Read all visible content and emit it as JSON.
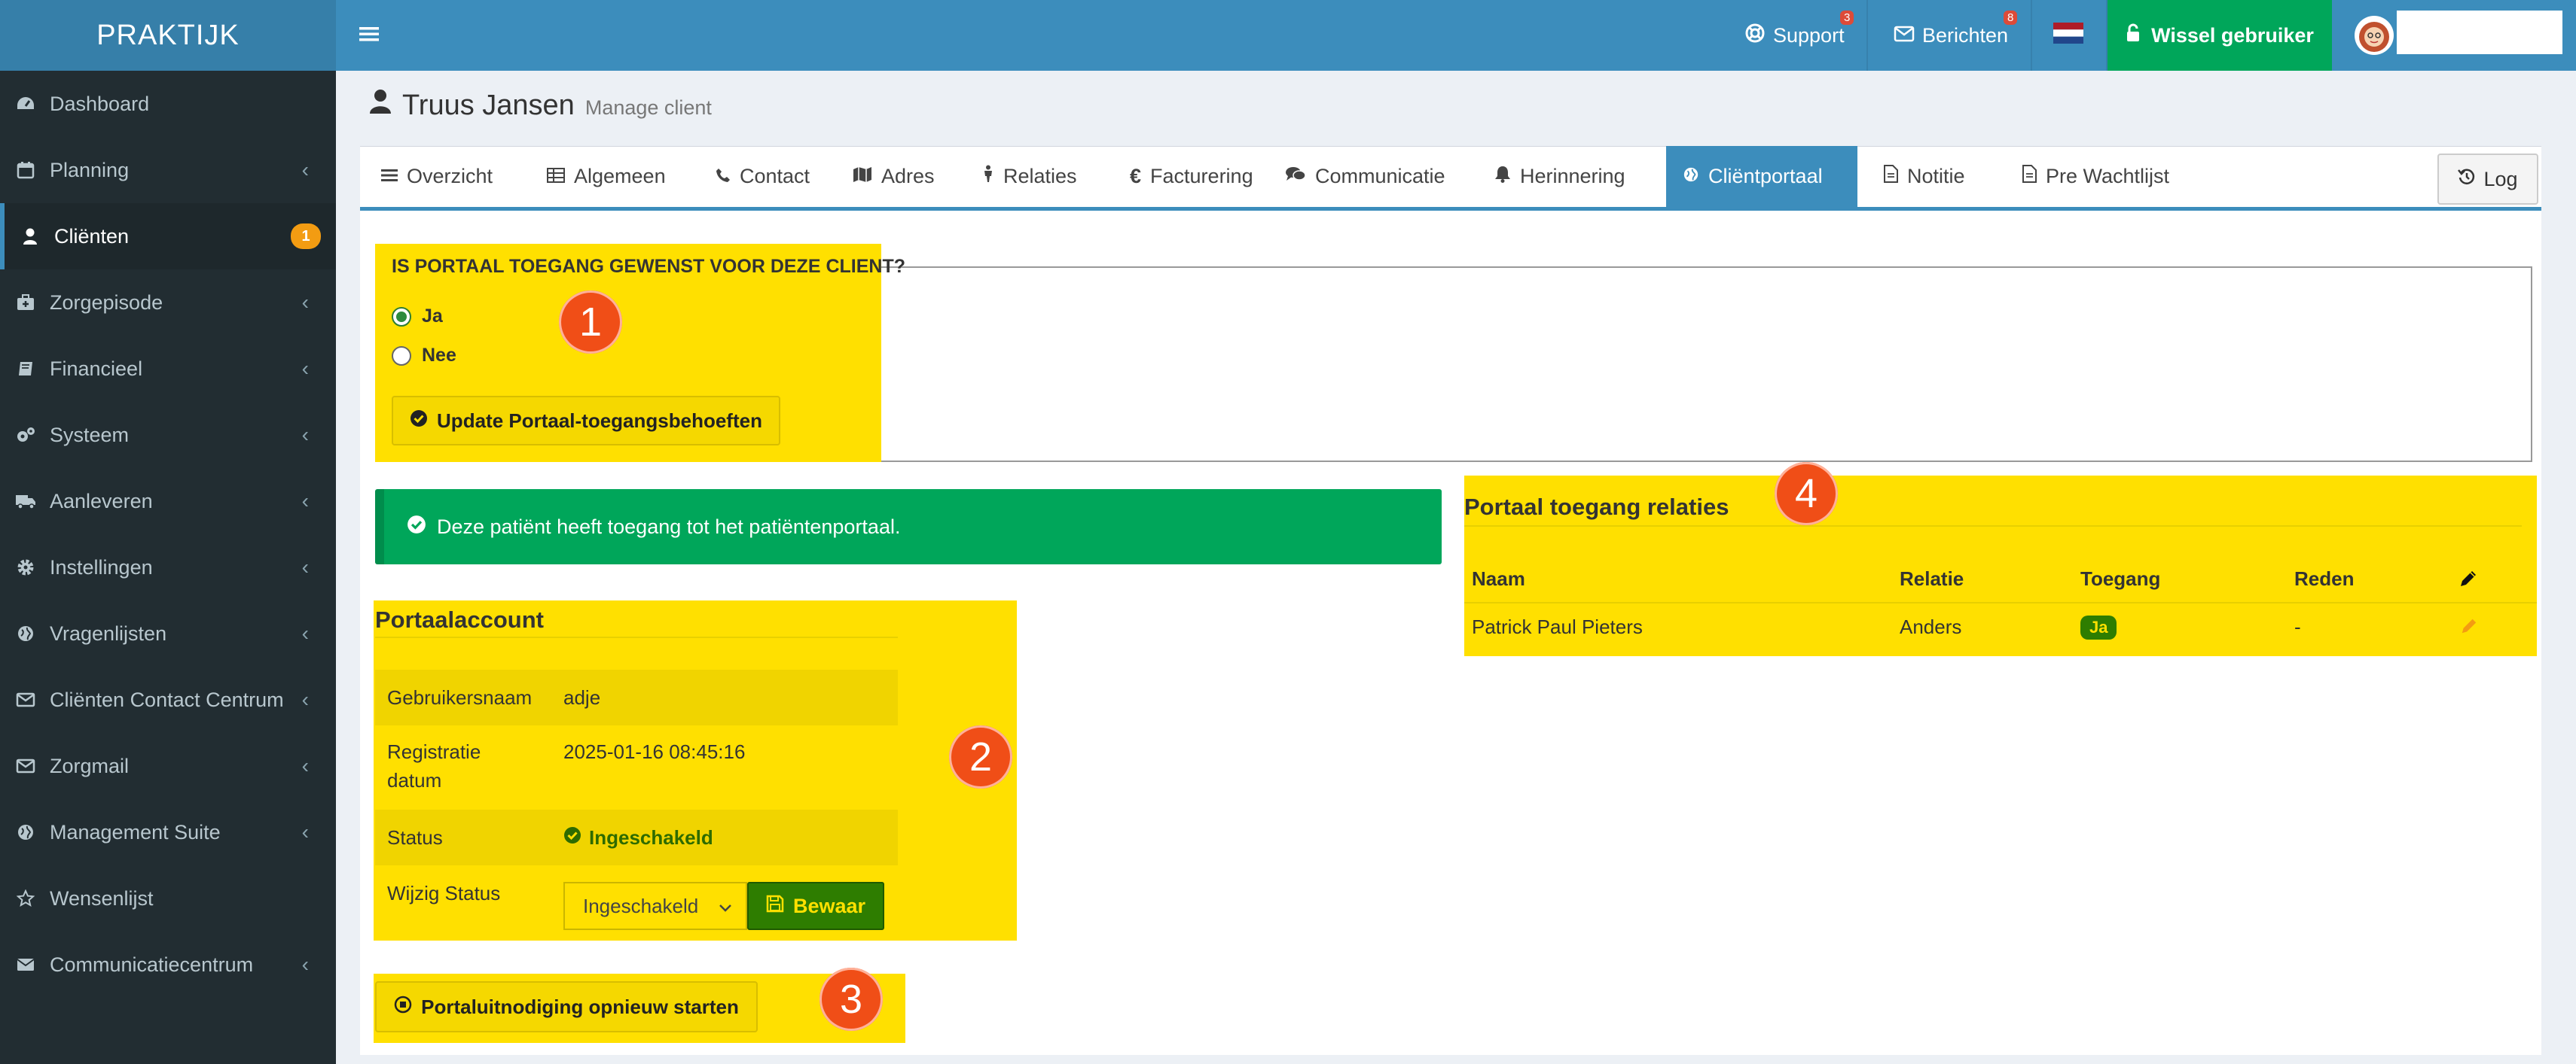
{
  "app": {
    "logo": "PRAKTIJK"
  },
  "sidebar": {
    "items": [
      {
        "label": "Dashboard",
        "icon": "dashboard-icon",
        "chevron": false
      },
      {
        "label": "Planning",
        "icon": "calendar-icon",
        "chevron": true
      },
      {
        "label": "Cliënten",
        "icon": "user-icon",
        "chevron": false,
        "badge": "1",
        "active": true
      },
      {
        "label": "Zorgepisode",
        "icon": "medkit-icon",
        "chevron": true
      },
      {
        "label": "Financieel",
        "icon": "book-icon",
        "chevron": true
      },
      {
        "label": "Systeem",
        "icon": "cogs-icon",
        "chevron": true
      },
      {
        "label": "Aanleveren",
        "icon": "truck-icon",
        "chevron": true
      },
      {
        "label": "Instellingen",
        "icon": "gear-icon",
        "chevron": true
      },
      {
        "label": "Vragenlijsten",
        "icon": "globe-icon",
        "chevron": true
      },
      {
        "label": "Cliënten Contact Centrum",
        "icon": "envelope-icon",
        "chevron": true
      },
      {
        "label": "Zorgmail",
        "icon": "envelope-icon",
        "chevron": true
      },
      {
        "label": "Management Suite",
        "icon": "globe-icon",
        "chevron": true
      },
      {
        "label": "Wensenlijst",
        "icon": "star-icon",
        "chevron": false
      },
      {
        "label": "Communicatiecentrum",
        "icon": "envelope-closed-icon",
        "chevron": true
      }
    ],
    "chevron_glyph": "‹"
  },
  "topbar": {
    "support_label": "Support",
    "support_count": "3",
    "berichten_label": "Berichten",
    "berichten_count": "8",
    "switch_user_label": "Wissel gebruiker"
  },
  "page": {
    "title": "Truus Jansen",
    "subtitle": "Manage client"
  },
  "tabs": [
    {
      "label": "Overzicht",
      "icon": "list-icon"
    },
    {
      "label": "Algemeen",
      "icon": "table-icon"
    },
    {
      "label": "Contact",
      "icon": "phone-icon"
    },
    {
      "label": "Adres",
      "icon": "map-icon"
    },
    {
      "label": "Relaties",
      "icon": "person-icon"
    },
    {
      "label": "Facturering",
      "icon": "euro-icon"
    },
    {
      "label": "Communicatie",
      "icon": "comments-icon"
    },
    {
      "label": "Herinnering",
      "icon": "bell-icon"
    },
    {
      "label": "Cliëntportaal",
      "icon": "globe-icon",
      "active": true
    },
    {
      "label": "Notitie",
      "icon": "file-icon"
    },
    {
      "label": "Pre Wachtlijst",
      "icon": "file-icon"
    }
  ],
  "log_button": "Log",
  "portal_access": {
    "legend": "IS PORTAAL TOEGANG GEWENST VOOR DEZE CLIENT?",
    "option_yes": "Ja",
    "option_no": "Nee",
    "selected": "Ja",
    "update_button": "Update Portaal-toegangsbehoeften"
  },
  "alert": {
    "text": "Deze patiënt heeft toegang tot het patiëntenportaal."
  },
  "account": {
    "title": "Portaalaccount",
    "username_label": "Gebruikersnaam",
    "username_value": "adje",
    "reg_label_1": "Registratie",
    "reg_label_2": "datum",
    "reg_value": "2025-01-16 08:45:16",
    "status_label": "Status",
    "status_value": "Ingeschakeld",
    "change_label": "Wijzig Status",
    "change_selected": "Ingeschakeld",
    "save_button": "Bewaar"
  },
  "restart_button": "Portaluitnodiging opnieuw starten",
  "relations": {
    "title": "Portaal toegang relaties",
    "headers": [
      "Naam",
      "Relatie",
      "Toegang",
      "Reden"
    ],
    "rows": [
      {
        "naam": "Patrick Paul Pieters",
        "relatie": "Anders",
        "toegang": "Ja",
        "reden": "-"
      }
    ]
  },
  "annotations": [
    "1",
    "2",
    "3",
    "4"
  ],
  "colors": {
    "highlight": "#ffe000",
    "marker": "#f04e17",
    "primary": "#3c8dbc",
    "success": "#00a65a",
    "sidebar": "#222d32"
  }
}
